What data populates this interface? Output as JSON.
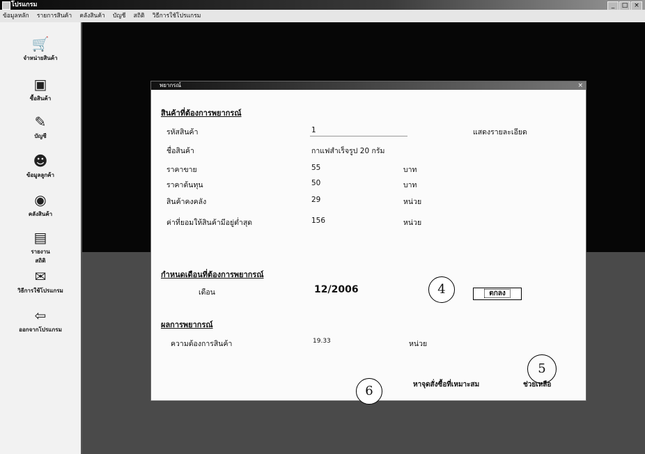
{
  "window": {
    "title": "โปรแกรม"
  },
  "menubar": {
    "items": [
      "ข้อมูลหลัก",
      "รายการสินค้า",
      "คลังสินค้า",
      "บัญชี",
      "สถิติ",
      "วิธีการใช้โปรแกรม"
    ]
  },
  "sidebar": {
    "items": [
      {
        "label": "จำหน่ายสินค้า",
        "icon": "cart-icon"
      },
      {
        "label": "ซื้อสินค้า",
        "icon": "purchase-icon"
      },
      {
        "label": "บัญชี",
        "icon": "accounts-icon"
      },
      {
        "label": "ข้อมูลลูกค้า",
        "icon": "customers-icon"
      },
      {
        "label": "คลังสินค้า",
        "icon": "warehouse-icon"
      },
      {
        "label": "รายงาน",
        "icon": "report-icon"
      },
      {
        "label": "สถิติ",
        "icon": "statistics-icon"
      },
      {
        "label": "วิธีการใช้โปรแกรม",
        "icon": "help-guide-icon"
      },
      {
        "label": "ออกจากโปรแกรม",
        "icon": "exit-icon"
      }
    ]
  },
  "dialog": {
    "title": "พยากรณ์",
    "product_section": {
      "heading": "สินค้าที่ต้องการพยากรณ์",
      "show_details": "แสดงรายละเอียด",
      "fields": [
        {
          "label": "รหัสสินค้า",
          "value": "1",
          "unit": ""
        },
        {
          "label": "ชื่อสินค้า",
          "value": "กาแฟสำเร็จรูป 20 กรัม",
          "unit": ""
        },
        {
          "label": "ราคาขาย",
          "value": "55",
          "unit": "บาท"
        },
        {
          "label": "ราคาต้นทุน",
          "value": "50",
          "unit": "บาท"
        },
        {
          "label": "สินค้าคงคลัง",
          "value": "29",
          "unit": "หน่วย"
        },
        {
          "label": "ค่าที่ยอมให้สินค้ามีอยู่ต่ำสุด",
          "value": "156",
          "unit": "หน่วย"
        }
      ]
    },
    "month_section": {
      "heading": "กำหนดเดือนที่ต้องการพยากรณ์",
      "label": "เดือน",
      "value": "12/2006",
      "ok_button": "ตกลง"
    },
    "result_section": {
      "heading": "ผลการพยากรณ์",
      "label": "ความต้องการสินค้า",
      "value": "19.33",
      "unit": "หน่วย"
    },
    "footer": {
      "reorder_link": "หาจุดสั่งซื้อที่เหมาะสม",
      "help_link": "ช่วยเหลือ"
    },
    "callouts": [
      "4",
      "5",
      "6"
    ]
  }
}
